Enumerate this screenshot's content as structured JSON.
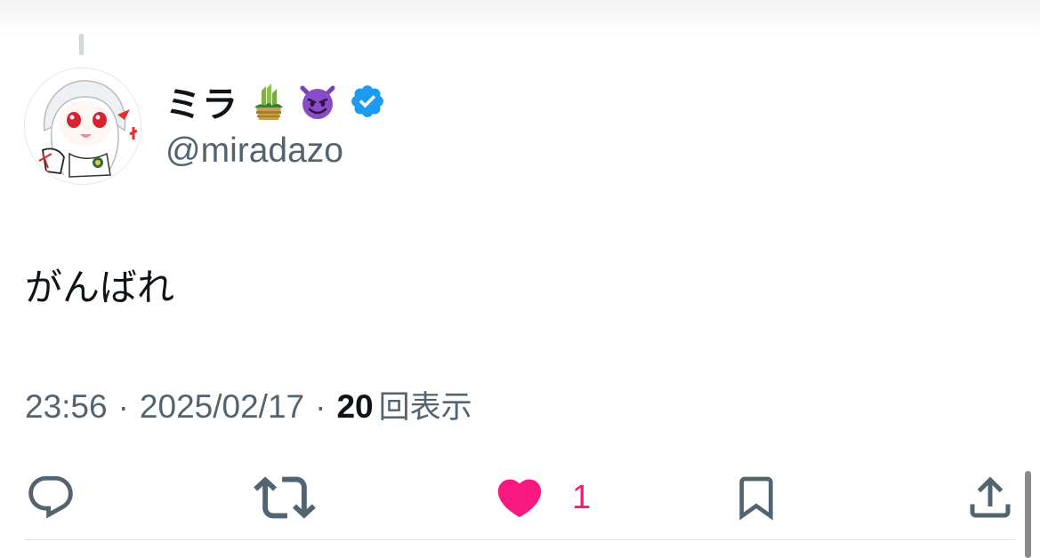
{
  "tweet": {
    "author": {
      "display_name": "ミラ",
      "handle": "@miradazo",
      "emojis": [
        "kadomatsu-emoji",
        "smiling-imp-emoji"
      ],
      "verified": true
    },
    "text": "がんばれ",
    "time": "23:56",
    "separator": "·",
    "date": "2025/02/17",
    "views_count": "20",
    "views_label": "回表示",
    "actions": {
      "reply_icon": "reply-icon",
      "retweet_icon": "retweet-icon",
      "like_icon": "heart-icon",
      "like_count": "1",
      "bookmark_icon": "bookmark-icon",
      "share_icon": "share-icon"
    }
  },
  "colors": {
    "primary_text": "#0f1419",
    "secondary_text": "#536471",
    "like_active": "#f91880",
    "verified_blue": "#1d9bf0",
    "divider": "#dfe3e6"
  }
}
